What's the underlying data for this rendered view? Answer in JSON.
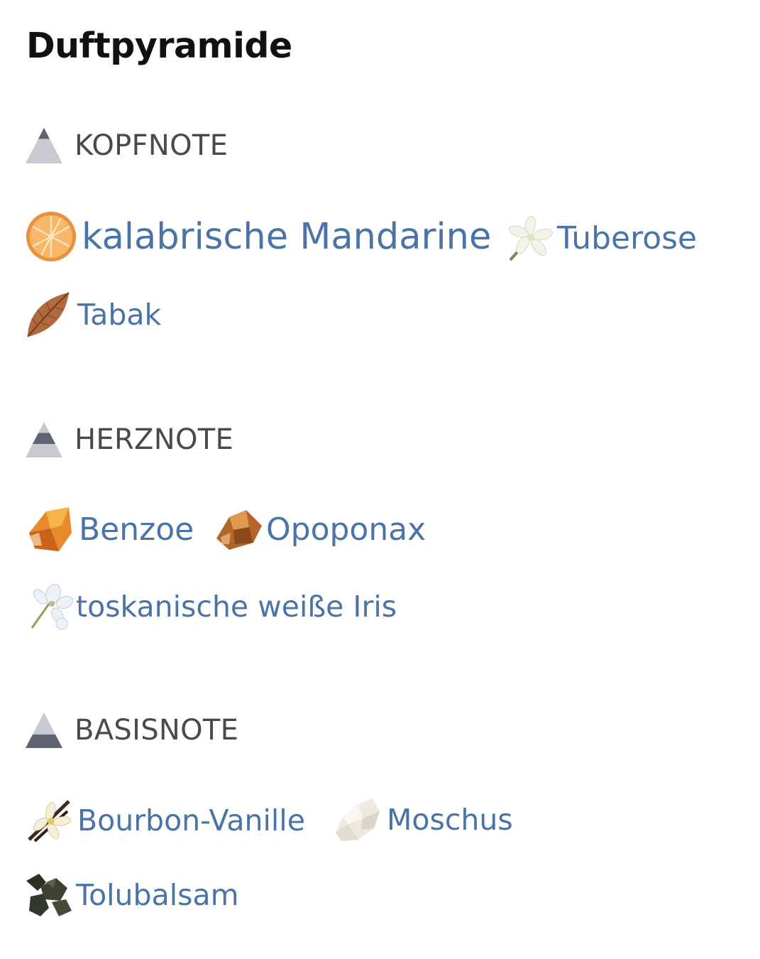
{
  "title": "Duftpyramide",
  "sections": [
    {
      "label": "KOPFNOTE",
      "level": "top",
      "notes": [
        {
          "label": "kalabrische Mandarine",
          "icon": "mandarin-slice-icon"
        },
        {
          "label": "Tuberose",
          "icon": "tuberose-flower-icon"
        },
        {
          "label": "Tabak",
          "icon": "tobacco-leaf-icon"
        }
      ]
    },
    {
      "label": "HERZNOTE",
      "level": "middle",
      "notes": [
        {
          "label": "Benzoe",
          "icon": "benzoin-resin-icon"
        },
        {
          "label": "Opoponax",
          "icon": "opoponax-resin-icon"
        },
        {
          "label": "toskanische weiße Iris",
          "icon": "iris-flower-icon"
        }
      ]
    },
    {
      "label": "BASISNOTE",
      "level": "base",
      "notes": [
        {
          "label": "Bourbon-Vanille",
          "icon": "vanilla-flower-icon"
        },
        {
          "label": "Moschus",
          "icon": "musk-crystal-icon"
        },
        {
          "label": "Tolubalsam",
          "icon": "tolu-balsam-icon"
        }
      ]
    }
  ],
  "colors": {
    "link": "#4a73a8",
    "heading": "#111111",
    "section_label": "#4a4a4a",
    "pyramid_light": "#c9c9d1",
    "pyramid_dark": "#5e6472"
  }
}
